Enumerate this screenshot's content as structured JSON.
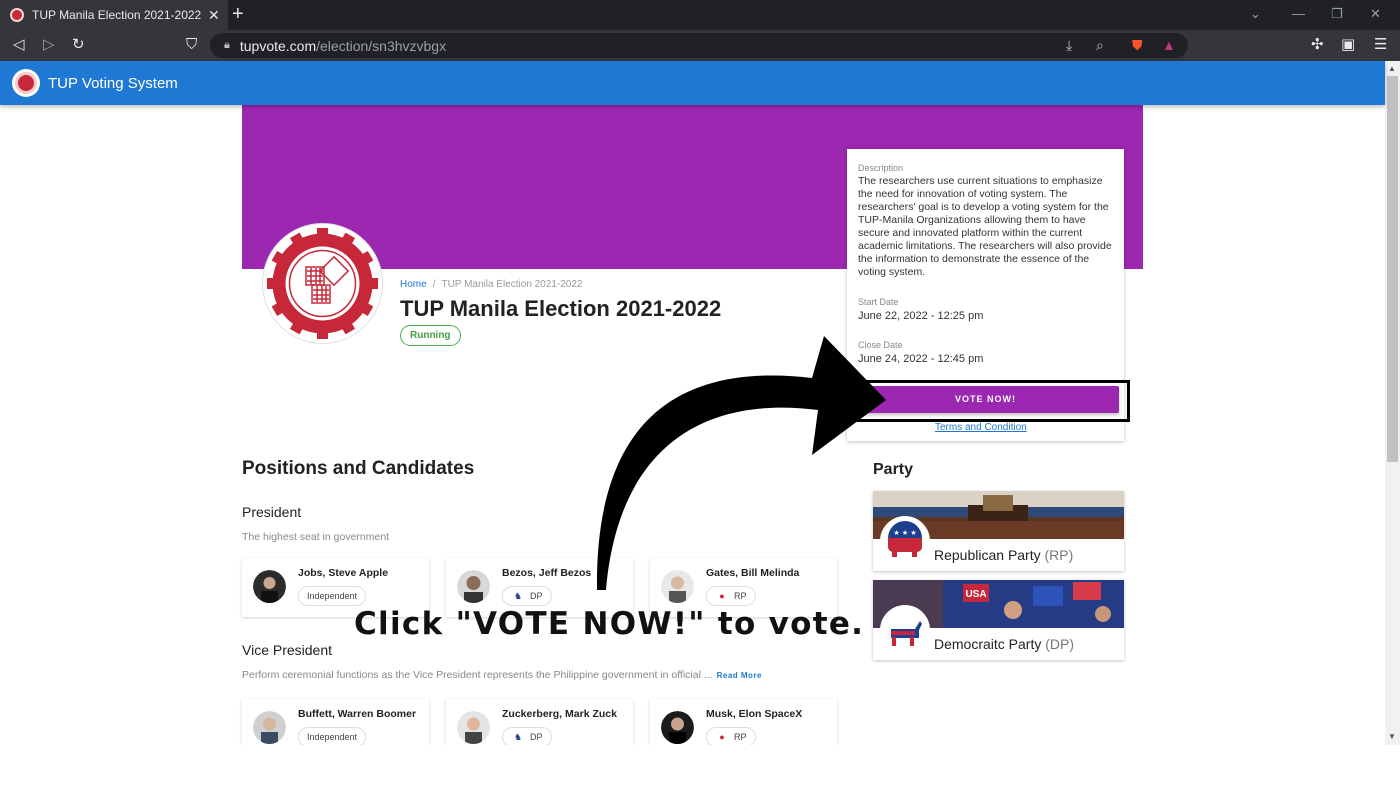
{
  "browser": {
    "tab_title": "TUP Manila Election 2021-2022 | T",
    "url_host": "tupvote.com",
    "url_path": "/election/sn3hvzvbgx"
  },
  "app": {
    "name": "TUP Voting System"
  },
  "election": {
    "breadcrumb_home": "Home",
    "breadcrumb_sep": "/",
    "breadcrumb_current": "TUP Manila Election 2021-2022",
    "title": "TUP Manila Election 2021-2022",
    "status": "Running",
    "seal_text": "TECHNOLOGICAL UNIVERSITY OF THE PHILIPPINES",
    "seal_year": "1901"
  },
  "info": {
    "description_label": "Description",
    "description": "The researchers use current situations to emphasize the need for innovation of voting system. The researchers' goal is to develop a voting system for the TUP-Manila Organizations allowing them to have secure and innovated platform within the current academic limitations. The researchers will also provide the information to demonstrate the essence of the voting system.",
    "start_label": "Start Date",
    "start_date": "June 22, 2022 - 12:25 pm",
    "close_label": "Close Date",
    "close_date": "June 24, 2022 - 12:45 pm",
    "vote_button": "VOTE NOW!",
    "terms_link": "Terms and Condition"
  },
  "positions_heading": "Positions and Candidates",
  "positions": [
    {
      "name": "President",
      "description": "The highest seat in government",
      "candidates": [
        {
          "name": "Jobs, Steve Apple",
          "party": "Independent"
        },
        {
          "name": "Bezos, Jeff Bezos",
          "party": "DP"
        },
        {
          "name": "Gates, Bill Melinda",
          "party": "RP"
        }
      ]
    },
    {
      "name": "Vice President",
      "description": "Perform ceremonial functions as the Vice President represents the Philippine government in official ...",
      "read_more": "Read More",
      "candidates": [
        {
          "name": "Buffett, Warren Boomer",
          "party": "Independent"
        },
        {
          "name": "Zuckerberg, Mark Zuck",
          "party": "DP"
        },
        {
          "name": "Musk, Elon SpaceX",
          "party": "RP"
        }
      ]
    }
  ],
  "party_heading": "Party",
  "parties": [
    {
      "name": "Republican Party",
      "abbr": "(RP)",
      "banner_text": ""
    },
    {
      "name": "Democraitc Party",
      "abbr": "(DP)",
      "banner_text": "USA"
    }
  ],
  "annotation": {
    "caption": "Click \"VOTE NOW!\" to vote."
  },
  "colors": {
    "app_bar": "#1e78d4",
    "banner": "#9c27b0",
    "status": "#43a047",
    "seal": "#c62839"
  }
}
